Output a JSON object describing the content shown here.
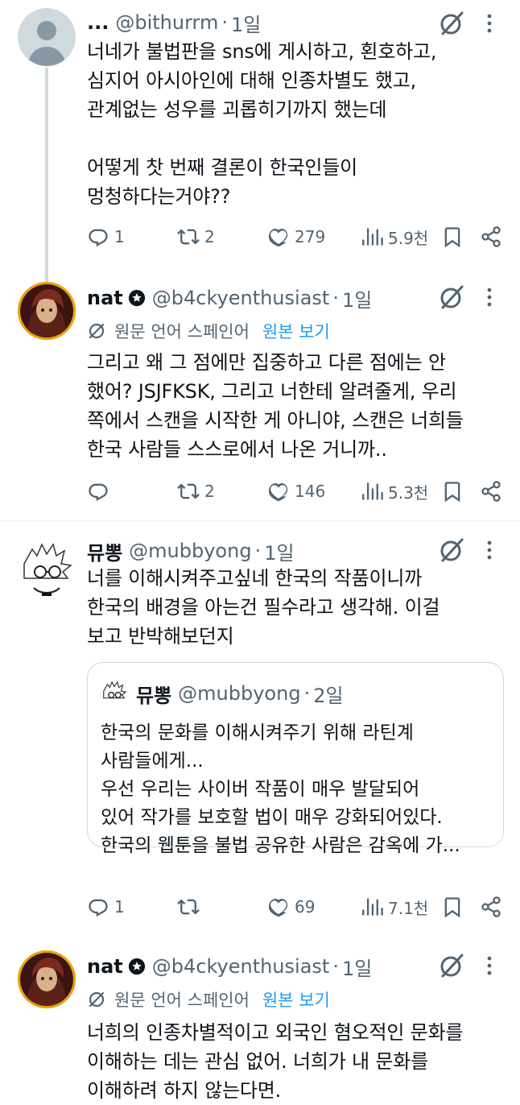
{
  "tweets": [
    {
      "name": "...",
      "handle": "@bithurrm",
      "time": "1일",
      "text": "너네가 불법판을 sns에 게시하고, 횐호하고,\n심지어 아시아인에 대해 인종차별도 했고,\n관계없는 성우를 괴롭히기까지 했는데\n\n어떻게 찻 번째 결론이 한국인들이\n멍청하다는거야??",
      "replies": "1",
      "retweets": "2",
      "likes": "279",
      "views": "5.9천"
    },
    {
      "name": "nat",
      "handle": "@b4ckyenthusiast",
      "time": "1일",
      "translate_label": "원문 언어 스페인어",
      "translate_link": "원본 보기",
      "text": "그리고 왜 그 점에만 집중하고 다른 점에는 안\n했어? JSJFKSK, 그리고 너한테 알려줄게, 우리\n쪽에서 스캔을 시작한 게 아니야, 스캔은 너희들\n한국 사람들 스스로에서 나온 거니까..",
      "replies": "",
      "retweets": "2",
      "likes": "146",
      "views": "5.3천"
    },
    {
      "name": "뮤뽕",
      "handle": "@mubbyong",
      "time": "1일",
      "text": "너를 이해시켜주고싶네 한국의 작품이니까\n한국의 배경을 아는건 필수라고 생각해. 이걸\n보고 반박해보던지",
      "quote": {
        "name": "뮤뽕",
        "handle": "@mubbyong",
        "time": "2일",
        "text": "한국의 문화를 이해시켜주기 위해 라틴계\n사람들에게...\n우선 우리는 사이버 작품이 매우 발달되어\n있어 작가를 보호할 법이 매우 강화되어있다.\n한국의 웹툰을 불법 공유한 사람은 감옥에 가..."
      },
      "replies": "1",
      "retweets": "",
      "likes": "69",
      "views": "7.1천"
    },
    {
      "name": "nat",
      "handle": "@b4ckyenthusiast",
      "time": "1일",
      "translate_label": "원문 언어 스페인어",
      "translate_link": "원본 보기",
      "text": "너희의 인종차별적이고 외국인 혐오적인 문화를\n이해하는 데는 관심 없어. 너희가 내 문화를\n이해하려 하지 않는다면."
    }
  ],
  "icons": {
    "reply": "reply-icon",
    "retweet": "retweet-icon",
    "like": "heart-icon",
    "views": "views-icon",
    "bookmark": "bookmark-icon",
    "share": "share-icon",
    "grok": "grok-icon",
    "more": "more-icon",
    "verified": "verified-badge-icon",
    "translate": "translate-icon"
  },
  "colors": {
    "text": "#0f1419",
    "secondary": "#536471",
    "link": "#1d9bf0",
    "thread_line": "#cfd9de"
  }
}
